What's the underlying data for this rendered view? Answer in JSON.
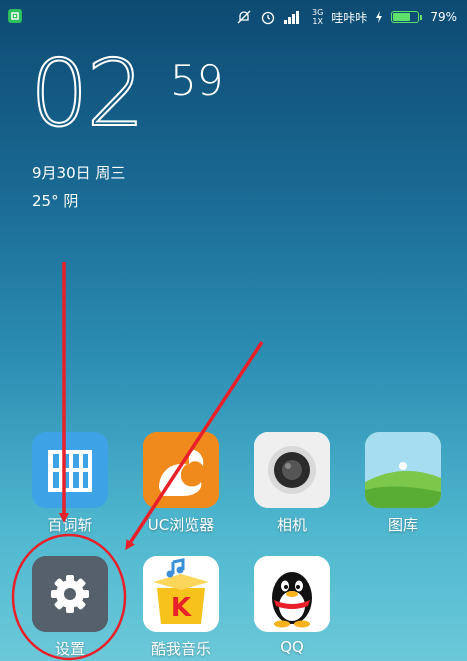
{
  "status_bar": {
    "carrier_text": "哇咔咔",
    "network_top": "3G",
    "network_bottom": "1X",
    "battery_percent": "79%",
    "battery_level": 0.79
  },
  "lockscreen": {
    "hour": "02",
    "minute": "59",
    "date": "9月30日 周三",
    "weather": "25° 阴"
  },
  "apps": [
    {
      "label": "百词斩",
      "icon": "baicizhan-icon"
    },
    {
      "label": "UC浏览器",
      "icon": "uc-browser-icon"
    },
    {
      "label": "相机",
      "icon": "camera-icon"
    },
    {
      "label": "图库",
      "icon": "gallery-icon"
    },
    {
      "label": "设置",
      "icon": "settings-gear-icon"
    },
    {
      "label": "酷我音乐",
      "icon": "kuwo-music-icon"
    },
    {
      "label": "QQ",
      "icon": "qq-penguin-icon"
    }
  ],
  "colors": {
    "annotation": "#e8202a",
    "battery": "#5ee06a",
    "uc_orange": "#f08a1c",
    "gallery_green": "#7cc84a"
  }
}
